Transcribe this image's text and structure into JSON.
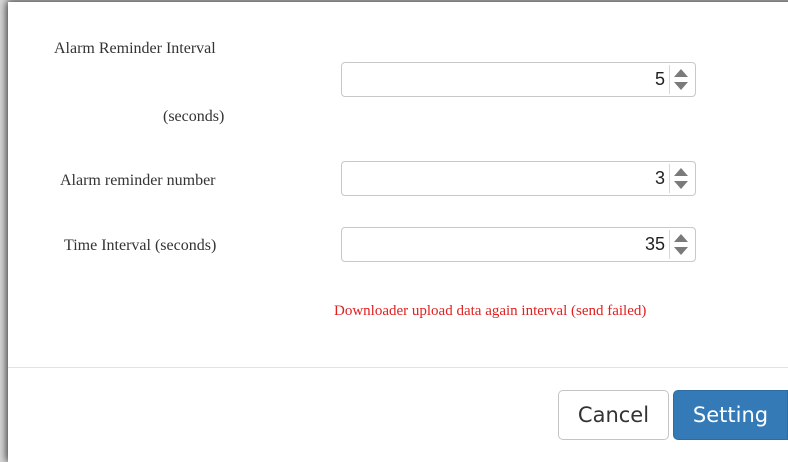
{
  "form": {
    "alarm_interval": {
      "label_line1": "Alarm Reminder Interval",
      "label_line2": "(seconds)",
      "value": "5"
    },
    "alarm_number": {
      "label": "Alarm reminder number",
      "value": "3"
    },
    "time_interval": {
      "label": "Time Interval (seconds)",
      "value": "35"
    },
    "hint": "Downloader upload data again interval (send failed)"
  },
  "footer": {
    "cancel_label": "Cancel",
    "setting_label": "Setting"
  },
  "colors": {
    "primary": "#337ab7",
    "hint": "#e02020"
  }
}
